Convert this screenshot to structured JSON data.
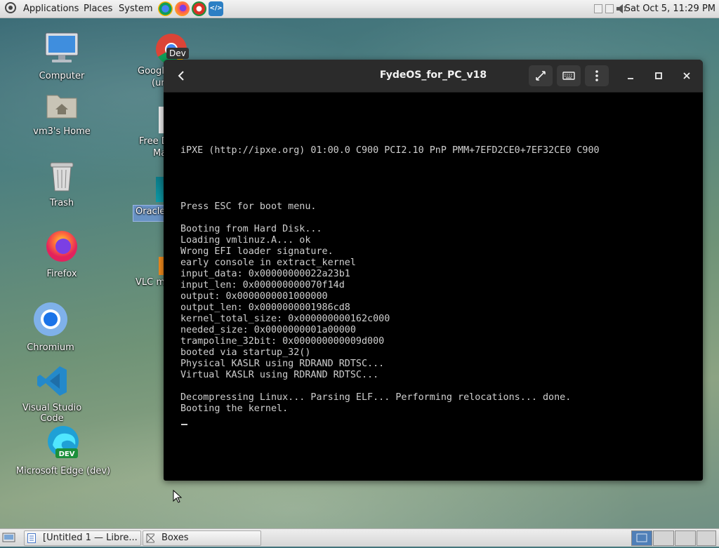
{
  "top_panel": {
    "menus": [
      "Applications",
      "Places",
      "System"
    ],
    "launchers": [
      {
        "name": "chrome-dev",
        "color": "#1a73e8"
      },
      {
        "name": "firefox",
        "color": "#ff7139"
      },
      {
        "name": "chromium-dev",
        "color": "#d93025"
      },
      {
        "name": "vscode",
        "color": "#2c7fc4"
      }
    ],
    "clock": "Sat Oct  5, 11:29 PM"
  },
  "desktop_icons": [
    {
      "label": "Computer",
      "icon": "computer-icon"
    },
    {
      "label": "vm3's Home",
      "icon": "home-folder-icon"
    },
    {
      "label": "Trash",
      "icon": "trash-icon"
    },
    {
      "label": "Firefox",
      "icon": "firefox-icon"
    },
    {
      "label": "Chromium",
      "icon": "chromium-icon"
    },
    {
      "label": "Visual Studio Code",
      "icon": "vscode-icon"
    },
    {
      "label": "Microsoft Edge (dev)",
      "icon": "edge-dev-icon"
    }
  ],
  "partial_icons": {
    "google_label_line1": "Googl",
    "google_label_line2": "(ur",
    "google_badge": "Dev",
    "free_label_line1": "Free D",
    "free_label_line2": "Ma",
    "oracle_label": "Oracle",
    "vlc_label": "VLC m"
  },
  "vm_window": {
    "title": "FydeOS_for_PC_v18",
    "console_lines": [
      "iPXE (http://ipxe.org) 01:00.0 C900 PCI2.10 PnP PMM+7EFD2CE0+7EF32CE0 C900",
      "Press ESC for boot menu.",
      "Booting from Hard Disk...",
      "Loading vmlinuz.A... ok",
      "Wrong EFI loader signature.",
      "early console in extract_kernel",
      "input_data: 0x00000000022a23b1",
      "input_len: 0x000000000070f14d",
      "output: 0x0000000001000000",
      "output_len: 0x0000000001986cd8",
      "kernel_total_size: 0x000000000162c000",
      "needed_size: 0x0000000001a00000",
      "trampoline_32bit: 0x000000000009d000",
      "booted via startup_32()",
      "Physical KASLR using RDRAND RDTSC...",
      "Virtual KASLR using RDRAND RDTSC...",
      "Decompressing Linux... Parsing ELF... Performing relocations... done.",
      "Booting the kernel."
    ]
  },
  "taskbar": {
    "tasks": [
      {
        "label": "[Untitled 1 — Libre..."
      },
      {
        "label": "Boxes"
      }
    ]
  },
  "colors": {
    "console_bg": "#000000",
    "console_fg": "#cfcfcf",
    "titlebar_bg": "#2b2b2b",
    "panel_bg": "#e6e6e6"
  }
}
